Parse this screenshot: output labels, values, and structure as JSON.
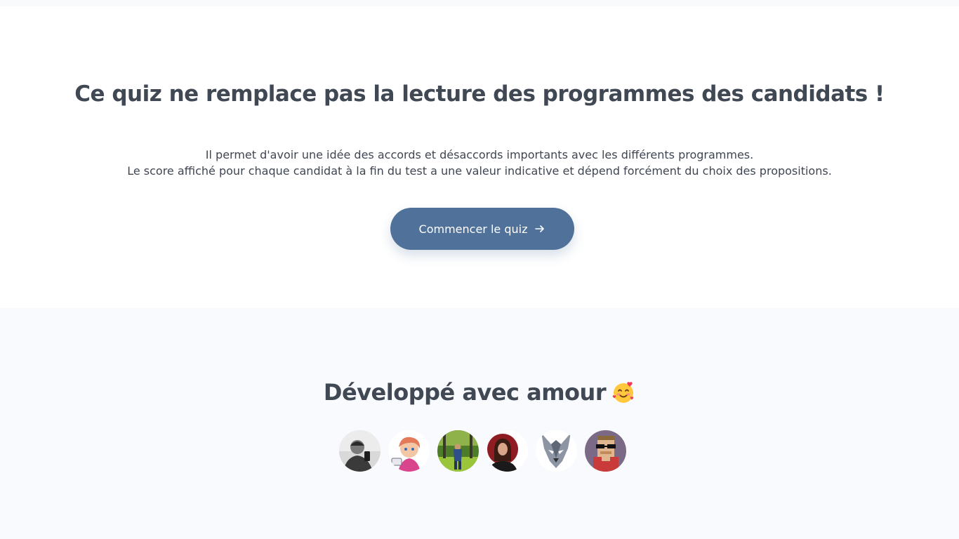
{
  "intro": {
    "headline": "Ce quiz ne remplace pas la lecture des programmes des candidats !",
    "description_line1": "Il permet d'avoir une idée des accords et désaccords importants avec les différents programmes.",
    "description_line2": "Le score affiché pour chaque candidat à la fin du test a une valeur indicative et dépend forcément du choix des propositions.",
    "cta_label": "Commencer le quiz",
    "cta_icon": "arrow-right-icon"
  },
  "credits": {
    "title": "Développé avec amour",
    "title_emoji": "smiling-face-with-hearts-emoji",
    "avatars": [
      {
        "name": "avatar-1"
      },
      {
        "name": "avatar-2"
      },
      {
        "name": "avatar-3"
      },
      {
        "name": "avatar-4"
      },
      {
        "name": "avatar-5"
      },
      {
        "name": "avatar-6"
      }
    ]
  },
  "colors": {
    "accent": "#4f719a",
    "heading": "#404854",
    "background_alt": "#f8fafd"
  }
}
